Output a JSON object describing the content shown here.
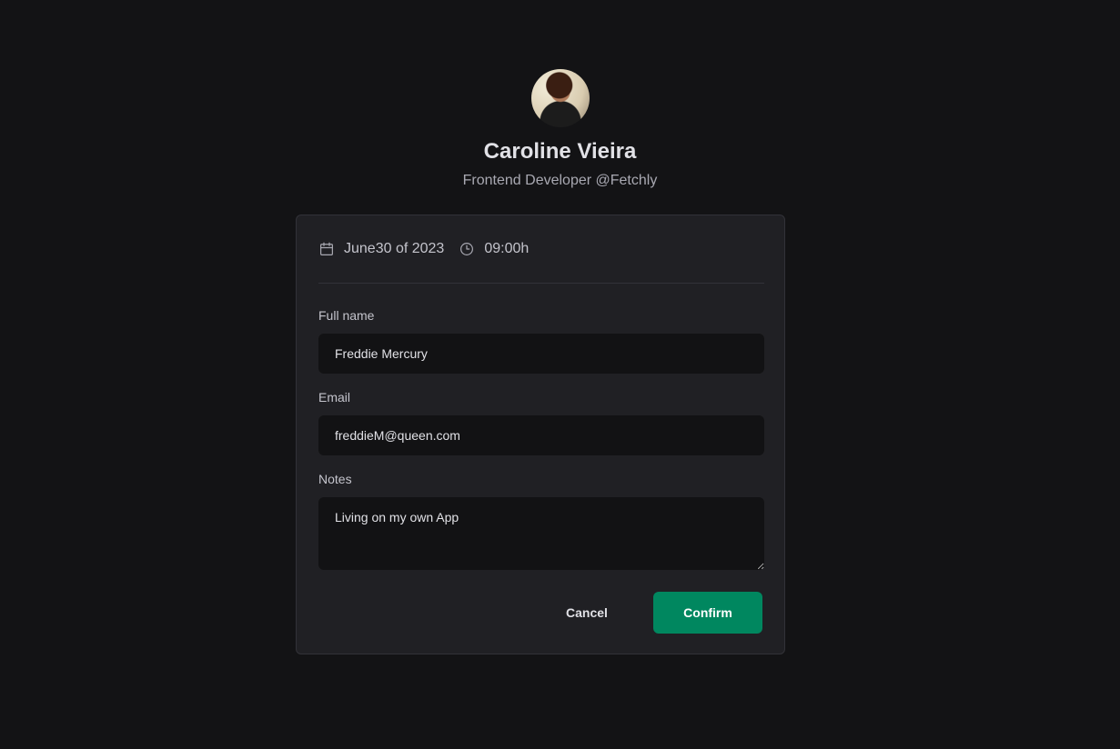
{
  "profile": {
    "name": "Caroline Vieira",
    "role": "Frontend Developer @Fetchly",
    "avatar_alt": "Caroline Vieira avatar"
  },
  "schedule": {
    "date": "June30 of 2023",
    "time": "09:00h",
    "date_icon": "calendar-icon",
    "time_icon": "clock-icon"
  },
  "form": {
    "full_name": {
      "label": "Full name",
      "value": "Freddie Mercury"
    },
    "email": {
      "label": "Email",
      "value": "freddieM@queen.com"
    },
    "notes": {
      "label": "Notes",
      "value": "Living on my own App"
    }
  },
  "actions": {
    "cancel_label": "Cancel",
    "confirm_label": "Confirm"
  },
  "colors": {
    "background": "#131315",
    "card": "#202024",
    "input": "#121214",
    "accent": "#00875f"
  }
}
